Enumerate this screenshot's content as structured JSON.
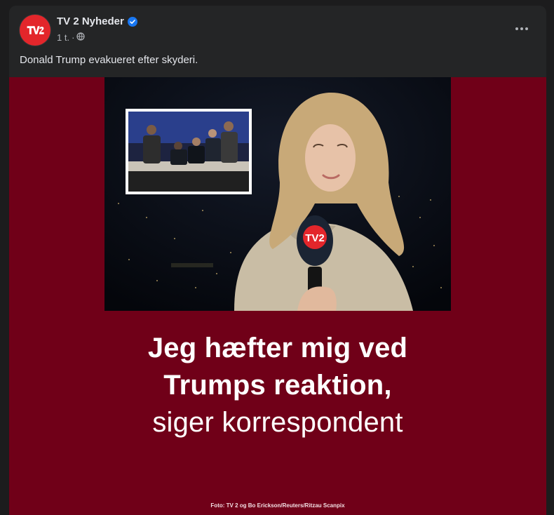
{
  "post": {
    "page_name": "TV 2 Nyheder",
    "timestamp": "1 t.",
    "separator": "·",
    "text": "Donald Trump evakueret efter skyderi."
  },
  "logo": {
    "text": "TV2"
  },
  "media": {
    "headline_bold_1": "Jeg hæfter mig ved",
    "headline_bold_2": "Trumps reaktion,",
    "headline_light": "siger korrespondent",
    "credit": "Foto: TV 2 og Bo Erickson/Reuters/Ritzau Scanpix",
    "background_color": "#700018"
  },
  "icons": {
    "verified": "verified-badge-icon",
    "audience": "globe-icon",
    "more": "more-options-icon"
  },
  "colors": {
    "card_bg": "#242526",
    "text_primary": "#e4e6eb",
    "text_secondary": "#b0b3b8",
    "tv2_red": "#e3262b",
    "verified_blue": "#1877f2"
  }
}
